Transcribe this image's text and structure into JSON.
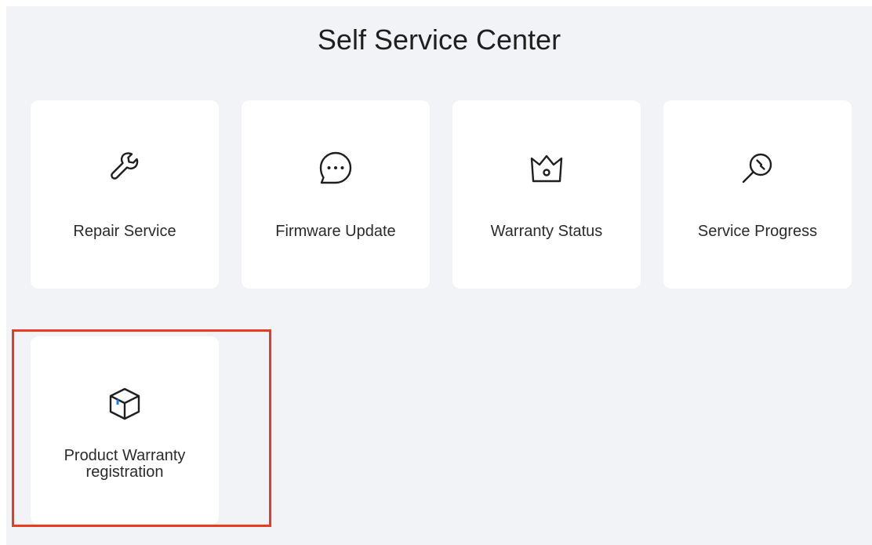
{
  "header": {
    "title": "Self Service Center"
  },
  "cards": [
    {
      "label": "Repair Service",
      "icon": "wrench-icon"
    },
    {
      "label": "Firmware Update",
      "icon": "chat-bubble-icon"
    },
    {
      "label": "Warranty Status",
      "icon": "crown-icon"
    },
    {
      "label": "Service Progress",
      "icon": "magnifier-icon"
    },
    {
      "label_line1": "Product Warranty",
      "label_line2": "registration",
      "icon": "box-icon"
    }
  ],
  "colors": {
    "background": "#f2f3f7",
    "card": "#ffffff",
    "highlight": "#ea3b1f",
    "accent": "#1e7bf0"
  }
}
